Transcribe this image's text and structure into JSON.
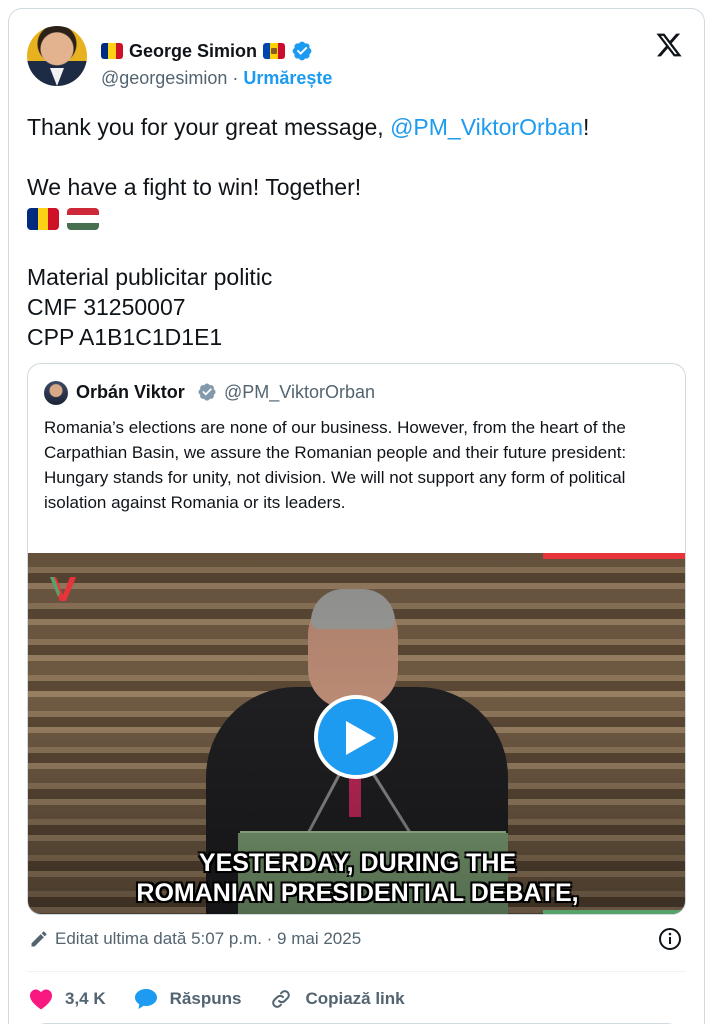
{
  "author": {
    "display_name": "George Simion",
    "handle": "@georgesimion",
    "separator": "·",
    "follow_label": "Urmărește",
    "verified": true
  },
  "tweet": {
    "lines": [
      {
        "before": "Thank you for your great message, ",
        "mention": "@PM_ViktorOrban",
        "after": "!"
      },
      {
        "text": "We have a fight to win! Together!"
      },
      {
        "text": "Material publicitar politic"
      },
      {
        "text": "CMF 31250007"
      },
      {
        "text": "CPP A1B1C1D1E1"
      }
    ],
    "flags": [
      "Romania",
      "Hungary"
    ]
  },
  "quoted": {
    "display_name": "Orbán Viktor",
    "handle": "@PM_ViktorOrban",
    "text": "Romania’s elections are none of our business. However, from the heart of the Carpathian Basin, we assure the Romanian people and their future president: Hungary stands for unity, not division. We will not support any form of political isolation against Romania or its leaders.",
    "video": {
      "caption_line1": "YESTERDAY, DURING THE",
      "caption_line2": "ROMANIAN PRESIDENTIAL DEBATE,"
    }
  },
  "meta": {
    "edited": "Editat ultima dată 5:07 p.m. · 9 mai 2025"
  },
  "actions": {
    "likes": "3,4 K",
    "reply_label": "Răspuns",
    "copy_link_label": "Copiază link"
  },
  "colors": {
    "accent": "#1d9bf0",
    "like": "#f91880",
    "text": "#0f1419",
    "muted": "#536471"
  },
  "icons": [
    "x-logo-icon",
    "verified-badge-icon",
    "gray-verified-badge-icon",
    "play-icon",
    "pencil-icon",
    "info-icon",
    "heart-icon",
    "reply-bubble-icon",
    "link-icon"
  ]
}
